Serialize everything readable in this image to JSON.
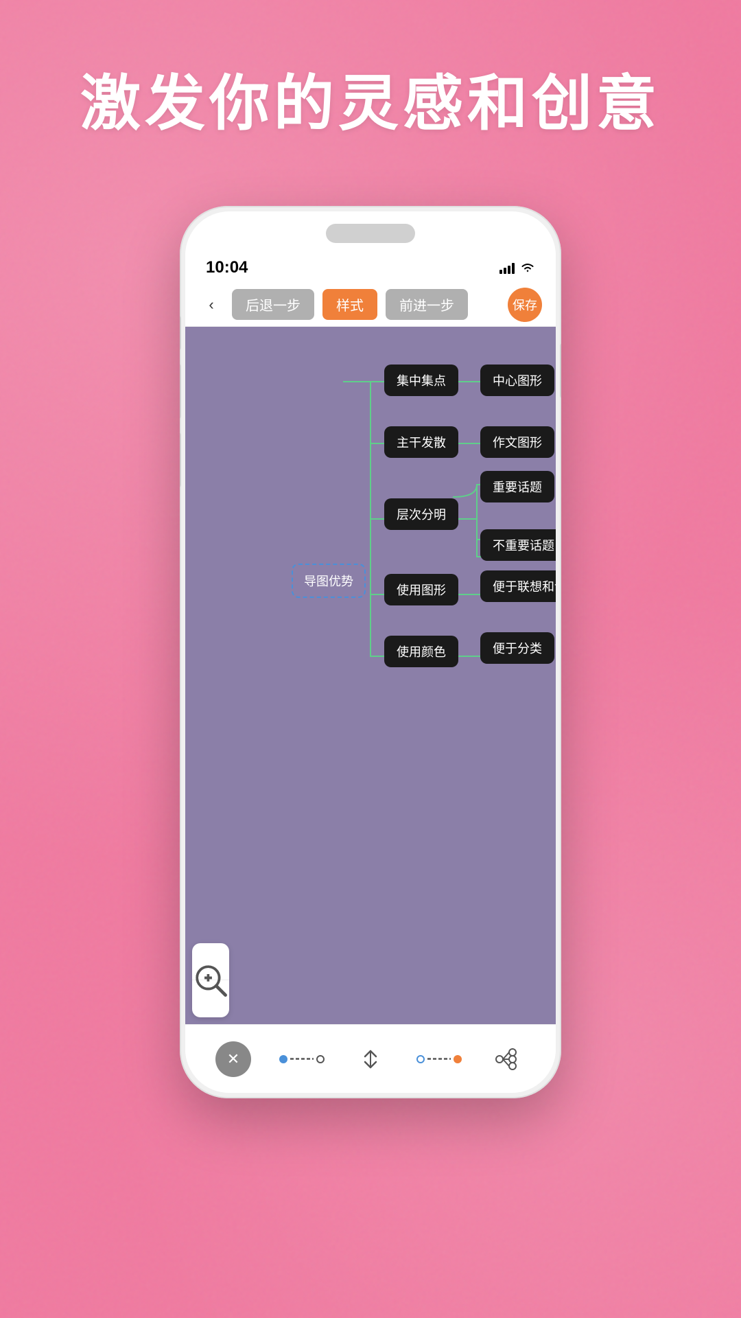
{
  "headline": "激发你的灵感和创意",
  "status_bar": {
    "time": "10:04",
    "signal": "▌▌▌▌",
    "wifi": "wifi"
  },
  "nav": {
    "back_label": "‹",
    "undo_label": "后退一步",
    "style_label": "样式",
    "redo_label": "前进一步",
    "save_label": "保存"
  },
  "mind_map": {
    "root_node": "导图优势",
    "nodes": [
      {
        "id": "n1",
        "label": "集中集点"
      },
      {
        "id": "n2",
        "label": "中心图形"
      },
      {
        "id": "n3",
        "label": "主干发散"
      },
      {
        "id": "n4",
        "label": "作文图形"
      },
      {
        "id": "n5",
        "label": "层次分明"
      },
      {
        "id": "n6",
        "label": "重要话题"
      },
      {
        "id": "n7",
        "label": "不重要话题"
      },
      {
        "id": "n8",
        "label": "使用图形"
      },
      {
        "id": "n9",
        "label": "便于联想和记忆"
      },
      {
        "id": "n10",
        "label": "使用颜色"
      },
      {
        "id": "n11",
        "label": "便于分类"
      }
    ]
  },
  "zoom": {
    "zoom_in_label": "+",
    "zoom_out_label": "−"
  },
  "toolbar": {
    "close_label": "✕",
    "compress_label": "⇥⇤"
  }
}
